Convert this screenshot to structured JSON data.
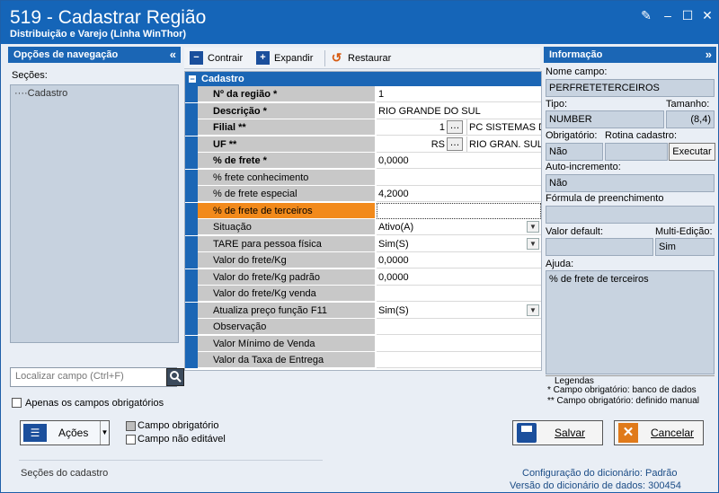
{
  "window": {
    "title": "519 - Cadastrar Região",
    "subtitle": "Distribuição e Varejo (Linha WinThor)"
  },
  "left": {
    "header": "Opções de navegação",
    "sections_label": "Seções:",
    "tree_items": [
      "Cadastro"
    ],
    "search_placeholder": "Localizar campo (Ctrl+F)",
    "required_only": "Apenas os campos obrigatórios"
  },
  "toolbar": {
    "contrair": "Contrair",
    "expandir": "Expandir",
    "restaurar": "Restaurar"
  },
  "grid": {
    "header": "Cadastro",
    "rows": [
      {
        "label": "Nº da região *",
        "value": "1",
        "bold": true
      },
      {
        "label": "Descrição *",
        "value": "RIO GRANDE DO SUL",
        "bold": true
      },
      {
        "label": "Filial **",
        "value": "1",
        "extra": "PC SISTEMAS DIS",
        "bold": true
      },
      {
        "label": "UF **",
        "value": "RS",
        "extra": "RIO GRAN. SUL",
        "bold": true
      },
      {
        "label": "% de frete *",
        "value": "0,0000",
        "bold": true
      },
      {
        "label": "% frete conhecimento",
        "value": ""
      },
      {
        "label": "% de frete especial",
        "value": "4,2000"
      },
      {
        "label": "% de frete de terceiros",
        "value": "",
        "selected": true
      },
      {
        "label": "Situação",
        "value": "Ativo(A)",
        "dropdown": true
      },
      {
        "label": "TARE para pessoa física",
        "value": "Sim(S)",
        "dropdown": true
      },
      {
        "label": "Valor do frete/Kg",
        "value": "0,0000"
      },
      {
        "label": "Valor do frete/Kg padrão",
        "value": "0,0000"
      },
      {
        "label": "Valor do frete/Kg venda",
        "value": ""
      },
      {
        "label": "Atualiza preço função F11",
        "value": "Sim(S)",
        "dropdown": true
      },
      {
        "label": "Observação",
        "value": ""
      },
      {
        "label": "Valor Mínimo de Venda",
        "value": ""
      },
      {
        "label": "Valor da Taxa de Entrega",
        "value": ""
      }
    ]
  },
  "info": {
    "header": "Informação",
    "nome_campo_label": "Nome campo:",
    "nome_campo": "PERFRETETERCEIROS",
    "tipo_label": "Tipo:",
    "tipo": "NUMBER",
    "tamanho_label": "Tamanho:",
    "tamanho": "(8,4)",
    "obrigatorio_label": "Obrigatório:",
    "obrigatorio": "Não",
    "rotina_label": "Rotina cadastro:",
    "executar": "Executar",
    "auto_label": "Auto-incremento:",
    "auto": "Não",
    "formula_label": "Fórmula de preenchimento",
    "default_label": "Valor default:",
    "multi_label": "Multi-Edição:",
    "multi": "Sim",
    "ajuda_label": "Ajuda:",
    "ajuda": "% de frete de terceiros",
    "legendas": "Legendas",
    "leg1": "* Campo obrigatório: banco de dados",
    "leg2": "** Campo obrigatório: definido manual"
  },
  "bottom": {
    "acoes": "Ações",
    "campo_obrig": "Campo obrigatório",
    "campo_nao_edit": "Campo não editável",
    "salvar": "Salvar",
    "cancelar": "Cancelar",
    "secoes": "Seções do cadastro",
    "config_label": "Configuração do dicionário:",
    "config_val": "Padrão",
    "versao_label": "Versão do dicionário de dados:",
    "versao_val": "300454"
  }
}
